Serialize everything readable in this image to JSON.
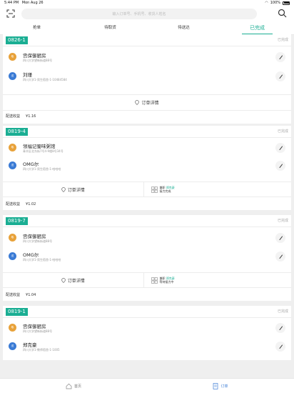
{
  "status": {
    "time": "5:44 PM",
    "date": "Mon Aug 26",
    "battery": "100%"
  },
  "search": {
    "placeholder": "输入订单号、手机号、收货人姓名"
  },
  "tabs": [
    {
      "label": "抢单",
      "active": false
    },
    {
      "label": "待取货",
      "active": false
    },
    {
      "label": "待送达",
      "active": false
    },
    {
      "label": "已完成",
      "active": true
    }
  ],
  "orders": [
    {
      "code": "0826-1",
      "status": "已完成",
      "pickup": {
        "tag": "取",
        "name": "宫保御厨房",
        "address": "四川大学望新街道88号"
      },
      "delivery": {
        "tag": "送",
        "name": "刘瑾",
        "address": "四川大学1-男生宿舍-1-10484584"
      },
      "detail": "订单详情",
      "earn_label": "配送收益",
      "earn_value": "¥1.16"
    },
    {
      "code": "0819-4",
      "status": "已完成",
      "pickup": {
        "tag": "取",
        "name": "领福记蜀味粥馆",
        "address": "青羊区北东街7号4-9楼8号34号"
      },
      "delivery": {
        "tag": "送",
        "name": "OMG尔",
        "address": "四川大学1-男生宿舍-1-哈哈哈"
      },
      "detail": "订单详情",
      "rider_label": "兼职",
      "rider_name": "郑克豪",
      "rider_status": "接力完成",
      "earn_label": "配送收益",
      "earn_value": "¥1.02"
    },
    {
      "code": "0819-7",
      "status": "已完成",
      "pickup": {
        "tag": "取",
        "name": "宫保御厨房",
        "address": "四川大学望新街道88号"
      },
      "delivery": {
        "tag": "送",
        "name": "OMG尔",
        "address": "四川大学1-男生宿舍-1-哈哈哈"
      },
      "detail": "订单详情",
      "rider_label": "兼职",
      "rider_name": "郑克豪",
      "rider_status": "等待接力中",
      "earn_label": "配送收益",
      "earn_value": "¥1.04"
    },
    {
      "code": "0819-1",
      "status": "已完成",
      "pickup": {
        "tag": "取",
        "name": "宫保御厨房",
        "address": "四川大学望新街道88号"
      },
      "delivery": {
        "tag": "送",
        "name": "郑克豪",
        "address": "四川大学1-教师宿舍-1-1005"
      }
    }
  ],
  "bottom_nav": [
    {
      "label": "首页",
      "icon": "home-icon",
      "active": false
    },
    {
      "label": "订单",
      "icon": "order-icon",
      "active": true
    }
  ],
  "colors": {
    "accent": "#1aae93",
    "pickup": "#e8a23a",
    "delivery": "#3a7bd5"
  }
}
